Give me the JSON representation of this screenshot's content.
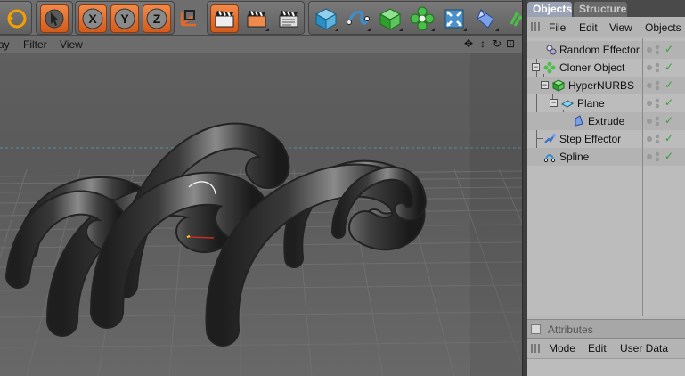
{
  "toolbar": {
    "icons": [
      "undo-icon",
      "pointer-icon",
      "x-axis-lock-icon",
      "y-axis-lock-icon",
      "z-axis-lock-icon",
      "coordinate-system-icon",
      "render-view-icon",
      "render-picture-viewer-icon",
      "render-settings-icon",
      "cube-icon",
      "spline-pen-icon",
      "nurbs-icon",
      "cloner-icon",
      "deformer-icon",
      "scene-icon"
    ],
    "x_label": "X",
    "y_label": "Y",
    "z_label": "Z"
  },
  "viewport_menu": {
    "display_label": "ay",
    "filter_label": "Filter",
    "view_label": "View"
  },
  "tabs": {
    "objects": "Objects",
    "structure": "Structure"
  },
  "object_manager_menu": {
    "file": "File",
    "edit": "Edit",
    "view": "View",
    "objects": "Objects"
  },
  "objects": [
    {
      "name": "Random Effector",
      "icon": "random-effector-icon"
    },
    {
      "name": "Cloner Object",
      "icon": "cloner-object-icon"
    },
    {
      "name": "HyperNURBS",
      "icon": "hypernurbs-icon"
    },
    {
      "name": "Plane",
      "icon": "plane-icon"
    },
    {
      "name": "Extrude",
      "icon": "extrude-icon"
    },
    {
      "name": "Step Effector",
      "icon": "step-effector-icon"
    },
    {
      "name": "Spline",
      "icon": "spline-icon"
    }
  ],
  "attributes": {
    "title": "Attributes",
    "mode": "Mode",
    "edit": "Edit",
    "user_data": "User Data"
  },
  "colors": {
    "accent_orange": "#e06a2a",
    "active_tab": "#9aa3b5",
    "check_green": "#3aa03a"
  }
}
